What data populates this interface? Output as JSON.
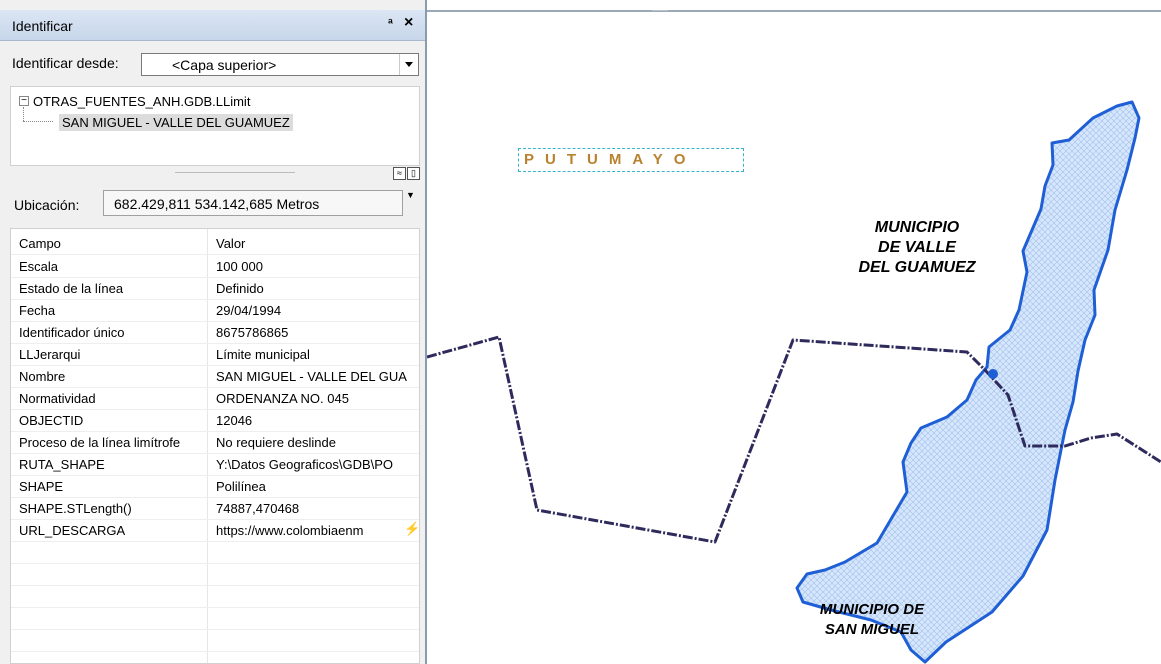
{
  "panel": {
    "title": "Identificar",
    "pin_glyph": "ª",
    "close_glyph": "×",
    "identify_from_label": "Identificar desde:",
    "identify_from_value": "<Capa superior>",
    "tree": {
      "layer": "OTRAS_FUENTES_ANH.GDB.LLimit",
      "feature": "SAN MIGUEL  - VALLE DEL GUAMUEZ"
    },
    "location_label": "Ubicación:",
    "location_value": "682.429,811  534.142,685 Metros",
    "table": {
      "headers": [
        "Campo",
        "Valor"
      ],
      "rows": [
        {
          "field": "Escala",
          "value": "100 000"
        },
        {
          "field": "Estado de la línea",
          "value": "Definido"
        },
        {
          "field": "Fecha",
          "value": "29/04/1994"
        },
        {
          "field": "Identificador único",
          "value": "8675786865"
        },
        {
          "field": "LLJerarqui",
          "value": "Límite municipal"
        },
        {
          "field": "Nombre",
          "value": "SAN MIGUEL  - VALLE DEL GUA"
        },
        {
          "field": "Normatividad",
          "value": "ORDENANZA NO. 045"
        },
        {
          "field": "OBJECTID",
          "value": "12046"
        },
        {
          "field": "Proceso de la línea limítrofe",
          "value": "No requiere deslinde"
        },
        {
          "field": "RUTA_SHAPE",
          "value": "Y:\\Datos Geograficos\\GDB\\PO"
        },
        {
          "field": "SHAPE",
          "value": "Polilínea"
        },
        {
          "field": "SHAPE.STLength()",
          "value": "74887,470468"
        },
        {
          "field": "URL_DESCARGA",
          "value": "https://www.colombiaenm"
        }
      ]
    },
    "icons": [
      "pin-icon",
      "close-icon",
      "dropdown-arrow-icon",
      "collapse-icon",
      "expand-icon",
      "grid-toggle-icon",
      "lightning-icon"
    ]
  },
  "map": {
    "department_label": "PUTUMAYO",
    "label_valle": [
      "MUNICIPIO",
      "DE VALLE",
      "DEL GUAMUEZ"
    ],
    "label_san_miguel": [
      "MUNICIPIO DE",
      "SAN MIGUEL"
    ],
    "colors": {
      "boundary": "#2e2a5c",
      "river": "#1f5fd6",
      "river_fill": "#d6e6fb",
      "department_label": "#b8822e",
      "selection_frame": "#36b3c9"
    }
  }
}
